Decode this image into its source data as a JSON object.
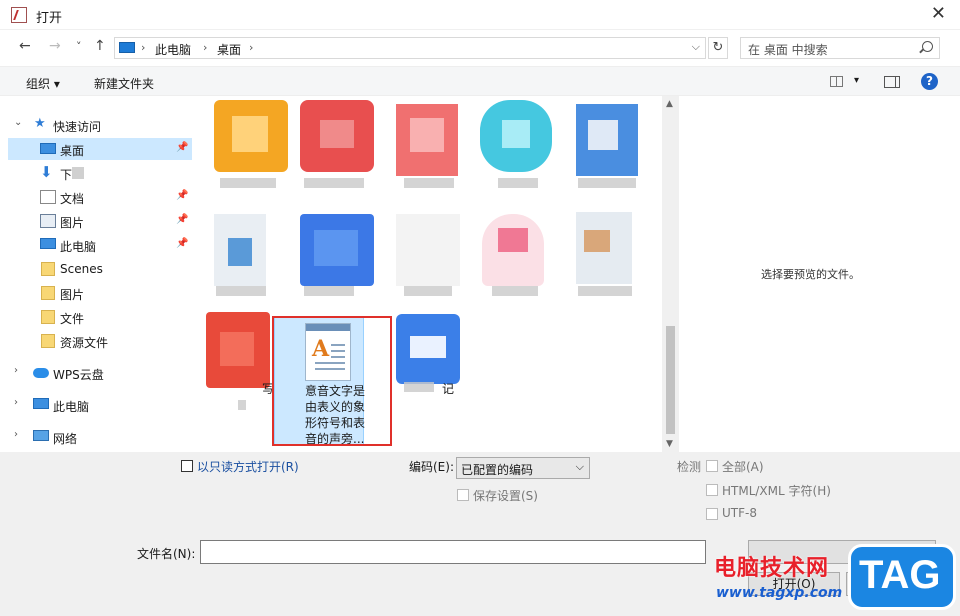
{
  "window": {
    "title": "打开",
    "close_glyph": "✕"
  },
  "nav": {
    "back": "←",
    "forward": "→",
    "recent": "˅",
    "up": "↑",
    "refresh": "↻"
  },
  "address": {
    "crumbs": [
      "此电脑",
      "桌面"
    ],
    "separator": "›",
    "dropdown": "⌵"
  },
  "search": {
    "placeholder": "在 桌面 中搜索"
  },
  "toolbar": {
    "organize": "组织 ▾",
    "new_folder": "新建文件夹",
    "view_dropdown": "▾",
    "help": "?"
  },
  "sidebar": {
    "items": [
      {
        "label": "快速访问",
        "icon": "star-icon",
        "glyph": "★",
        "expand": "⌄"
      },
      {
        "label": "桌面",
        "icon": "desktop-icon",
        "pinned": "📌"
      },
      {
        "label": "下",
        "icon": "download-icon",
        "glyph": "⬇"
      },
      {
        "label": "文档",
        "icon": "document-icon",
        "pinned": "📌"
      },
      {
        "label": "图片",
        "icon": "picture-icon",
        "pinned": "📌"
      },
      {
        "label": "此电脑",
        "icon": "computer-icon",
        "pinned": "📌"
      },
      {
        "label": "Scenes",
        "icon": "folder-icon"
      },
      {
        "label": "图片",
        "icon": "folder-icon"
      },
      {
        "label": "文件",
        "icon": "folder-icon"
      },
      {
        "label": "资源文件",
        "icon": "folder-icon"
      },
      {
        "label": "WPS云盘",
        "icon": "cloud-icon",
        "expand": "›"
      },
      {
        "label": "此电脑",
        "icon": "computer-icon",
        "expand": "›"
      },
      {
        "label": "网络",
        "icon": "network-icon",
        "expand": "›"
      }
    ]
  },
  "files": {
    "selected_name": "意音文字是由表义的象形符号和表音的声旁...",
    "partial_labels": [
      "写",
      "记"
    ]
  },
  "scrollbar": {
    "up": "▲",
    "down": "▼"
  },
  "preview": {
    "message": "选择要预览的文件。"
  },
  "options": {
    "readonly": "以只读方式打开(R)",
    "encoding_label": "编码(E):",
    "encoding_value": "已配置的编码",
    "encoding_arrow": "⌵",
    "keep_settings": "保存设置(S)",
    "detect_label": "检测",
    "detect_all": "全部(A)",
    "detect_html": "HTML/XML 字符(H)",
    "detect_utf8": "UTF-8"
  },
  "footer": {
    "filename_label": "文件名(N):",
    "filename_value": "",
    "open": "打开(O)"
  },
  "watermark": {
    "text": "电脑技术网",
    "url": "www.tagxp.com",
    "badge": "TAG"
  }
}
